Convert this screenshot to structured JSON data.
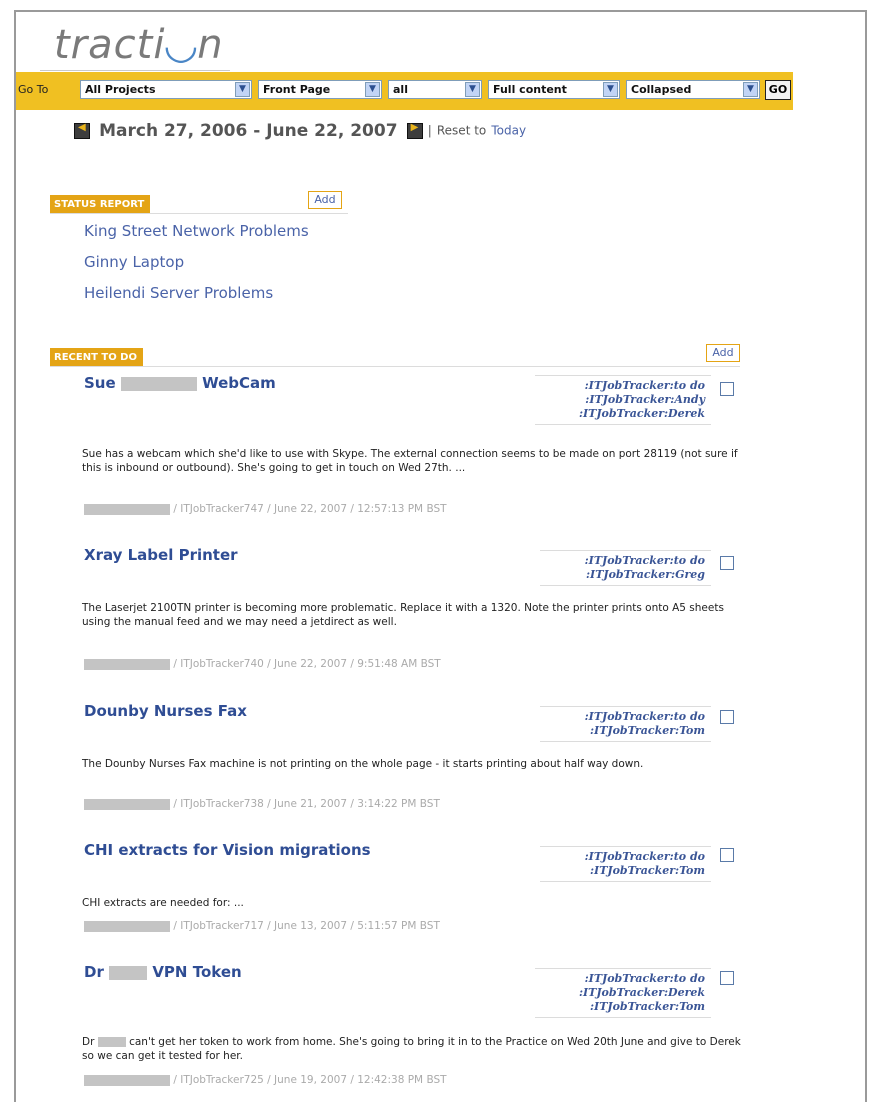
{
  "app": {
    "logo_text": "tracti⁠on"
  },
  "goto": {
    "label": "Go To",
    "selects": [
      "All Projects",
      "Front Page",
      "all",
      "Full content",
      "Collapsed"
    ],
    "go_label": "GO"
  },
  "date_range": {
    "text": "March 27, 2006 - June 22, 2007",
    "separator": "|",
    "reset_prefix": "Reset to",
    "today_link": "Today"
  },
  "status_report": {
    "title": "STATUS REPORT",
    "add_label": "Add",
    "items": [
      "King Street Network Problems",
      "Ginny Laptop",
      "Heilendi Server Problems"
    ]
  },
  "recent_todo": {
    "title": "RECENT TO DO",
    "add_label": "Add",
    "items": [
      {
        "title_prefix": "Sue",
        "title_suffix": "WebCam",
        "tags": [
          ":ITJobTracker:to do",
          ":ITJobTracker:Andy",
          ":ITJobTracker:Derek"
        ],
        "description": "Sue has a webcam which she'd like to use with Skype. The external connection seems to be made on port 28119 (not sure if this is inbound or outbound). She's going to get in touch on Wed 27th. ...",
        "meta": "/ ITJobTracker747 / June 22, 2007 / 12:57:13 PM BST"
      },
      {
        "title_prefix": "Xray Label Printer",
        "title_suffix": "",
        "tags": [
          ":ITJobTracker:to do",
          ":ITJobTracker:Greg"
        ],
        "description": "The Laserjet 2100TN printer is becoming more problematic. Replace it with a 1320. Note the printer prints onto A5 sheets using the manual feed and we may need a jetdirect as well.",
        "meta": "/ ITJobTracker740 / June 22, 2007 / 9:51:48 AM BST"
      },
      {
        "title_prefix": "Dounby Nurses Fax",
        "title_suffix": "",
        "tags": [
          ":ITJobTracker:to do",
          ":ITJobTracker:Tom"
        ],
        "description": "The Dounby Nurses Fax machine is not printing on the whole page - it starts printing about half way down.",
        "meta": "/ ITJobTracker738 / June 21, 2007 / 3:14:22 PM BST"
      },
      {
        "title_prefix": "CHI extracts for Vision migrations",
        "title_suffix": "",
        "tags": [
          ":ITJobTracker:to do",
          ":ITJobTracker:Tom"
        ],
        "description": "CHI extracts are needed for: ...",
        "meta": "/ ITJobTracker717 / June 13, 2007 / 5:11:57 PM BST"
      },
      {
        "title_prefix": "Dr",
        "title_suffix": "VPN Token",
        "tags": [
          ":ITJobTracker:to do",
          ":ITJobTracker:Derek",
          ":ITJobTracker:Tom"
        ],
        "description_prefix": "Dr",
        "description": "can't get her token to work from home. She's going to bring it in to the Practice on Wed 20th June and give to Derek so we can get it tested for her.",
        "meta": "/ ITJobTracker725 / June 19, 2007 / 12:42:38 PM BST"
      }
    ]
  },
  "colors": {
    "accent": "#f0c022",
    "tab": "#e4a415",
    "link": "#4a63a8",
    "title": "#2f4d94"
  }
}
